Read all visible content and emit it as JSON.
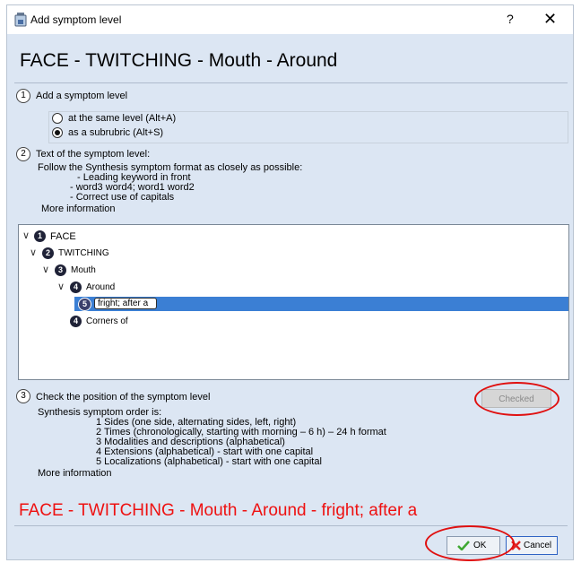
{
  "window": {
    "title": "Add symptom level",
    "help_label": "?",
    "close_label": "✕",
    "app_icon": "app-bottle-icon"
  },
  "heading": "FACE - TWITCHING - Mouth - Around",
  "section1": {
    "number": "1",
    "label": "Add a symptom level",
    "options": [
      {
        "label": "at the same level  (Alt+A)",
        "selected": false
      },
      {
        "label": "as a subrubric (Alt+S)",
        "selected": true
      }
    ]
  },
  "section2": {
    "number": "2",
    "label": "Text of the symptom level:",
    "intro": "Follow the Synthesis symptom format as closely as possible:",
    "rules": [
      "- Leading keyword in front",
      "- word3 word4; word1 word2",
      "- Correct use of capitals"
    ],
    "more_info": "More information"
  },
  "tree": {
    "nodes": [
      {
        "num": "1",
        "label": "FACE"
      },
      {
        "num": "2",
        "label": "TWITCHING"
      },
      {
        "num": "3",
        "label": "Mouth"
      },
      {
        "num": "4",
        "label": "Around"
      },
      {
        "num": "5",
        "label": "fright; after a"
      },
      {
        "num": "4",
        "label": "Corners of"
      }
    ]
  },
  "section3": {
    "number": "3",
    "label": "Check the position of the symptom level",
    "checked_button": "Checked",
    "intro": "Synthesis symptom order is:",
    "rules": [
      "1 Sides (one side, alternating sides, left, right)",
      "2 Times (chronologically, starting with morning – 6 h) – 24 h format",
      "3 Modalities and descriptions (alphabetical)",
      "4 Extensions (alphabetical) - start with one capital",
      "5 Localizations (alphabetical) - start with one capital"
    ],
    "more_info": "More information"
  },
  "result": "FACE - TWITCHING - Mouth - Around - fright; after a",
  "buttons": {
    "ok": "OK",
    "cancel": "Cancel"
  },
  "colors": {
    "accent": "#3b7fd4",
    "result_text": "#ee1111",
    "annotation": "#e01010",
    "node_badge": "#1f2237"
  }
}
